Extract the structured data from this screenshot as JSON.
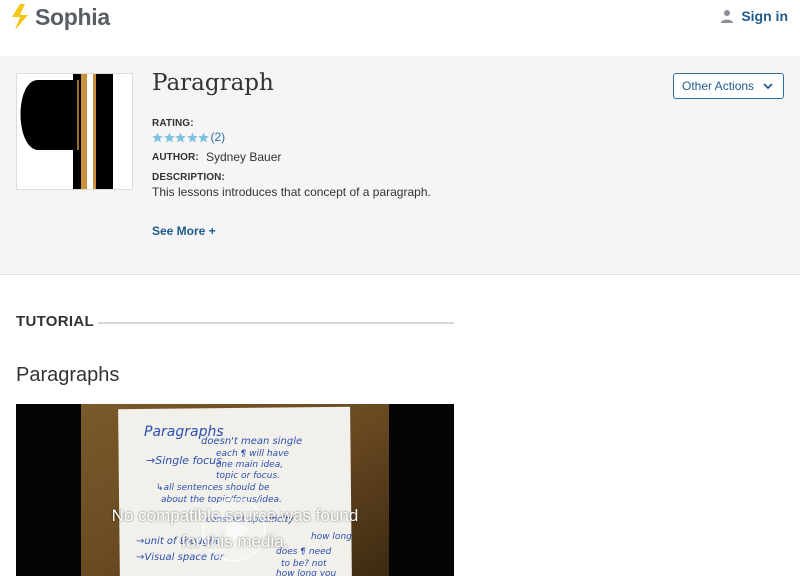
{
  "header": {
    "brand": "Sophia",
    "signin_label": "Sign in",
    "brand_color": "#f5c518",
    "link_color": "#1f5b8c"
  },
  "resource": {
    "title": "Paragraph",
    "thumbnail_glyph": "pilcrow-icon",
    "other_actions_label": "Other Actions",
    "rating_label": "RATING:",
    "rating_stars": 5,
    "rating_count": "(2)",
    "author_label": "AUTHOR:",
    "author_name": "Sydney Bauer",
    "description_label": "DESCRIPTION:",
    "description": "This lessons introduces that concept of a paragraph.",
    "see_more_label": "See More +"
  },
  "tutorial": {
    "section_label": "TUTORIAL",
    "title": "Paragraphs",
    "video_message_line1": "No compatible source was found",
    "video_message_line2": "for this media."
  },
  "video_paper_lines": [
    "Paragraphs",
    "doesn't mean single",
    "→Single focus",
    "each ¶ will have",
    "one main idea,",
    "topic or focus.",
    "↳all sentences should be",
    "about the topic/focus/idea.",
    "constant specificity",
    "→unit of thought",
    "→Visual space for",
    "how long",
    "does ¶ need",
    "to be? not",
    "how long you"
  ]
}
